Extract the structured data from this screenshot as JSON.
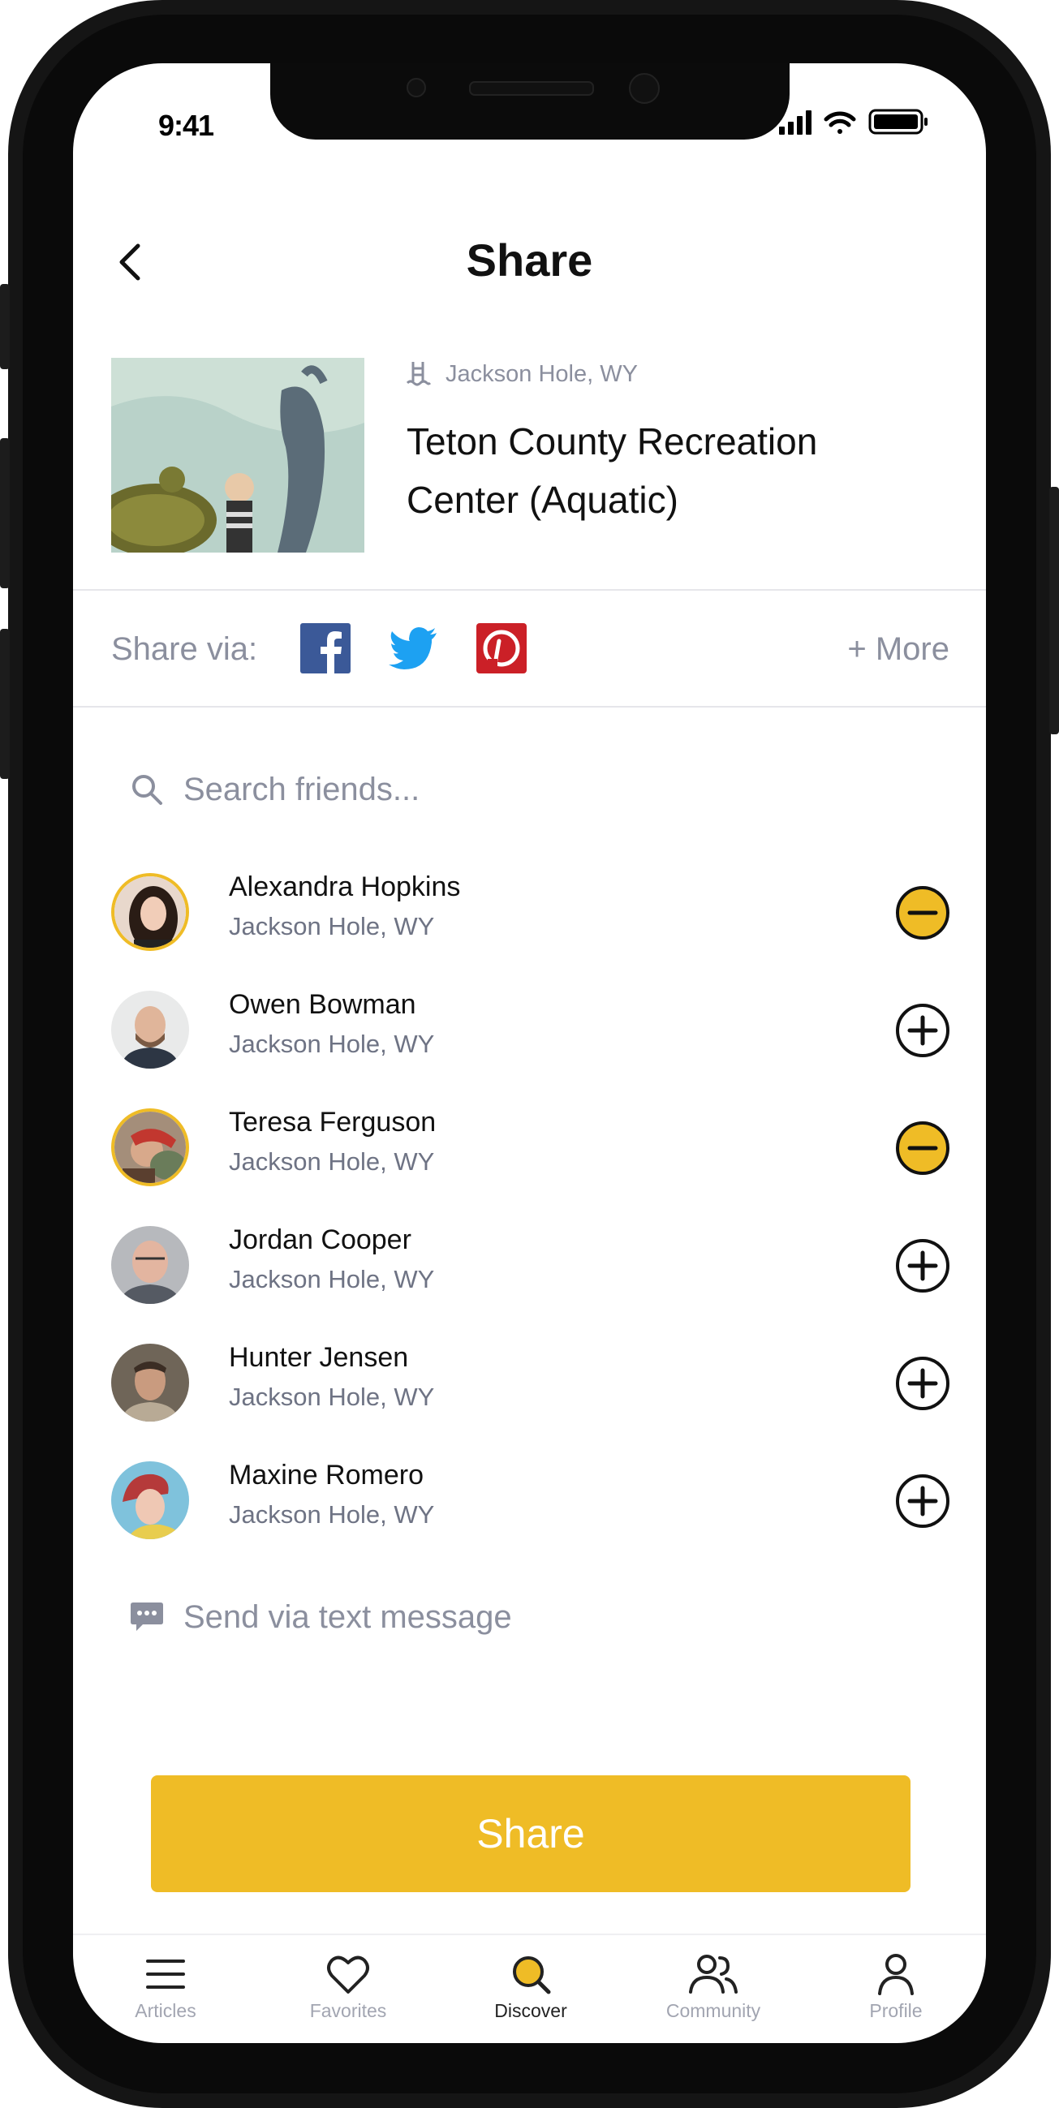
{
  "status_bar": {
    "time": "9:41"
  },
  "header": {
    "title": "Share"
  },
  "place": {
    "location": "Jackson Hole, WY",
    "title": "Teton County Recreation Center (Aquatic)"
  },
  "share_via": {
    "label": "Share via:",
    "more": "+ More"
  },
  "search": {
    "placeholder": "Search friends..."
  },
  "friends": [
    {
      "name": "Alexandra Hopkins",
      "location": "Jackson Hole, WY",
      "selected": true
    },
    {
      "name": "Owen Bowman",
      "location": "Jackson Hole, WY",
      "selected": false
    },
    {
      "name": "Teresa Ferguson",
      "location": "Jackson Hole, WY",
      "selected": true
    },
    {
      "name": "Jordan Cooper",
      "location": "Jackson Hole, WY",
      "selected": false
    },
    {
      "name": "Hunter Jensen",
      "location": "Jackson Hole, WY",
      "selected": false
    },
    {
      "name": "Maxine Romero",
      "location": "Jackson Hole, WY",
      "selected": false
    }
  ],
  "sms": {
    "label": "Send via text message"
  },
  "share_button": {
    "label": "Share"
  },
  "tabs": [
    {
      "label": "Articles",
      "icon": "menu-icon",
      "active": false
    },
    {
      "label": "Favorites",
      "icon": "heart-icon",
      "active": false
    },
    {
      "label": "Discover",
      "icon": "search-icon",
      "active": true
    },
    {
      "label": "Community",
      "icon": "community-icon",
      "active": false
    },
    {
      "label": "Profile",
      "icon": "profile-icon",
      "active": false
    }
  ],
  "colors": {
    "accent": "#efbc26",
    "muted": "#8b8f9e",
    "facebook": "#3b5998",
    "twitter": "#1da1f2",
    "pinterest": "#cb2027"
  }
}
